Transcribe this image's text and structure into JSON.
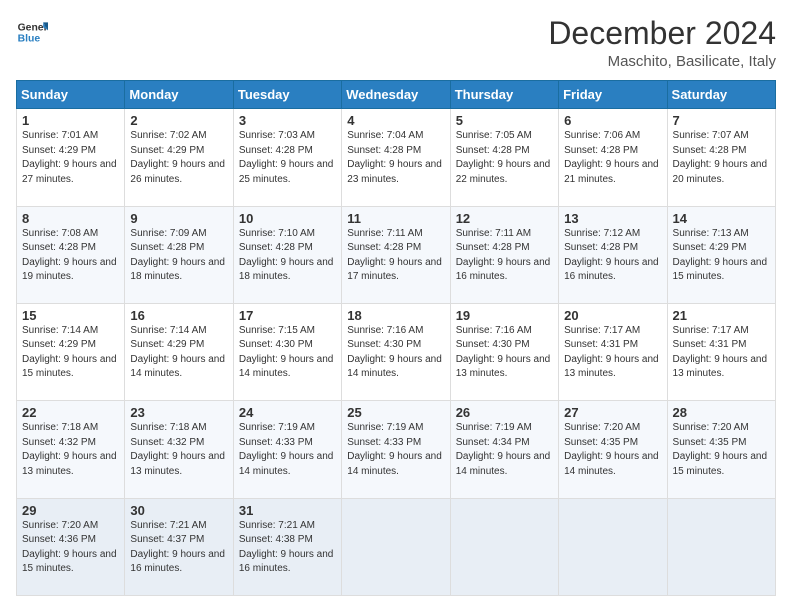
{
  "logo": {
    "line1": "General",
    "line2": "Blue"
  },
  "title": "December 2024",
  "subtitle": "Maschito, Basilicate, Italy",
  "days_of_week": [
    "Sunday",
    "Monday",
    "Tuesday",
    "Wednesday",
    "Thursday",
    "Friday",
    "Saturday"
  ],
  "weeks": [
    [
      {
        "day": "1",
        "sunrise": "7:01 AM",
        "sunset": "4:29 PM",
        "daylight": "9 hours and 27 minutes."
      },
      {
        "day": "2",
        "sunrise": "7:02 AM",
        "sunset": "4:29 PM",
        "daylight": "9 hours and 26 minutes."
      },
      {
        "day": "3",
        "sunrise": "7:03 AM",
        "sunset": "4:28 PM",
        "daylight": "9 hours and 25 minutes."
      },
      {
        "day": "4",
        "sunrise": "7:04 AM",
        "sunset": "4:28 PM",
        "daylight": "9 hours and 23 minutes."
      },
      {
        "day": "5",
        "sunrise": "7:05 AM",
        "sunset": "4:28 PM",
        "daylight": "9 hours and 22 minutes."
      },
      {
        "day": "6",
        "sunrise": "7:06 AM",
        "sunset": "4:28 PM",
        "daylight": "9 hours and 21 minutes."
      },
      {
        "day": "7",
        "sunrise": "7:07 AM",
        "sunset": "4:28 PM",
        "daylight": "9 hours and 20 minutes."
      }
    ],
    [
      {
        "day": "8",
        "sunrise": "7:08 AM",
        "sunset": "4:28 PM",
        "daylight": "9 hours and 19 minutes."
      },
      {
        "day": "9",
        "sunrise": "7:09 AM",
        "sunset": "4:28 PM",
        "daylight": "9 hours and 18 minutes."
      },
      {
        "day": "10",
        "sunrise": "7:10 AM",
        "sunset": "4:28 PM",
        "daylight": "9 hours and 18 minutes."
      },
      {
        "day": "11",
        "sunrise": "7:11 AM",
        "sunset": "4:28 PM",
        "daylight": "9 hours and 17 minutes."
      },
      {
        "day": "12",
        "sunrise": "7:11 AM",
        "sunset": "4:28 PM",
        "daylight": "9 hours and 16 minutes."
      },
      {
        "day": "13",
        "sunrise": "7:12 AM",
        "sunset": "4:28 PM",
        "daylight": "9 hours and 16 minutes."
      },
      {
        "day": "14",
        "sunrise": "7:13 AM",
        "sunset": "4:29 PM",
        "daylight": "9 hours and 15 minutes."
      }
    ],
    [
      {
        "day": "15",
        "sunrise": "7:14 AM",
        "sunset": "4:29 PM",
        "daylight": "9 hours and 15 minutes."
      },
      {
        "day": "16",
        "sunrise": "7:14 AM",
        "sunset": "4:29 PM",
        "daylight": "9 hours and 14 minutes."
      },
      {
        "day": "17",
        "sunrise": "7:15 AM",
        "sunset": "4:30 PM",
        "daylight": "9 hours and 14 minutes."
      },
      {
        "day": "18",
        "sunrise": "7:16 AM",
        "sunset": "4:30 PM",
        "daylight": "9 hours and 14 minutes."
      },
      {
        "day": "19",
        "sunrise": "7:16 AM",
        "sunset": "4:30 PM",
        "daylight": "9 hours and 13 minutes."
      },
      {
        "day": "20",
        "sunrise": "7:17 AM",
        "sunset": "4:31 PM",
        "daylight": "9 hours and 13 minutes."
      },
      {
        "day": "21",
        "sunrise": "7:17 AM",
        "sunset": "4:31 PM",
        "daylight": "9 hours and 13 minutes."
      }
    ],
    [
      {
        "day": "22",
        "sunrise": "7:18 AM",
        "sunset": "4:32 PM",
        "daylight": "9 hours and 13 minutes."
      },
      {
        "day": "23",
        "sunrise": "7:18 AM",
        "sunset": "4:32 PM",
        "daylight": "9 hours and 13 minutes."
      },
      {
        "day": "24",
        "sunrise": "7:19 AM",
        "sunset": "4:33 PM",
        "daylight": "9 hours and 14 minutes."
      },
      {
        "day": "25",
        "sunrise": "7:19 AM",
        "sunset": "4:33 PM",
        "daylight": "9 hours and 14 minutes."
      },
      {
        "day": "26",
        "sunrise": "7:19 AM",
        "sunset": "4:34 PM",
        "daylight": "9 hours and 14 minutes."
      },
      {
        "day": "27",
        "sunrise": "7:20 AM",
        "sunset": "4:35 PM",
        "daylight": "9 hours and 14 minutes."
      },
      {
        "day": "28",
        "sunrise": "7:20 AM",
        "sunset": "4:35 PM",
        "daylight": "9 hours and 15 minutes."
      }
    ],
    [
      {
        "day": "29",
        "sunrise": "7:20 AM",
        "sunset": "4:36 PM",
        "daylight": "9 hours and 15 minutes."
      },
      {
        "day": "30",
        "sunrise": "7:21 AM",
        "sunset": "4:37 PM",
        "daylight": "9 hours and 16 minutes."
      },
      {
        "day": "31",
        "sunrise": "7:21 AM",
        "sunset": "4:38 PM",
        "daylight": "9 hours and 16 minutes."
      },
      null,
      null,
      null,
      null
    ]
  ],
  "labels": {
    "sunrise": "Sunrise:",
    "sunset": "Sunset:",
    "daylight": "Daylight:"
  }
}
